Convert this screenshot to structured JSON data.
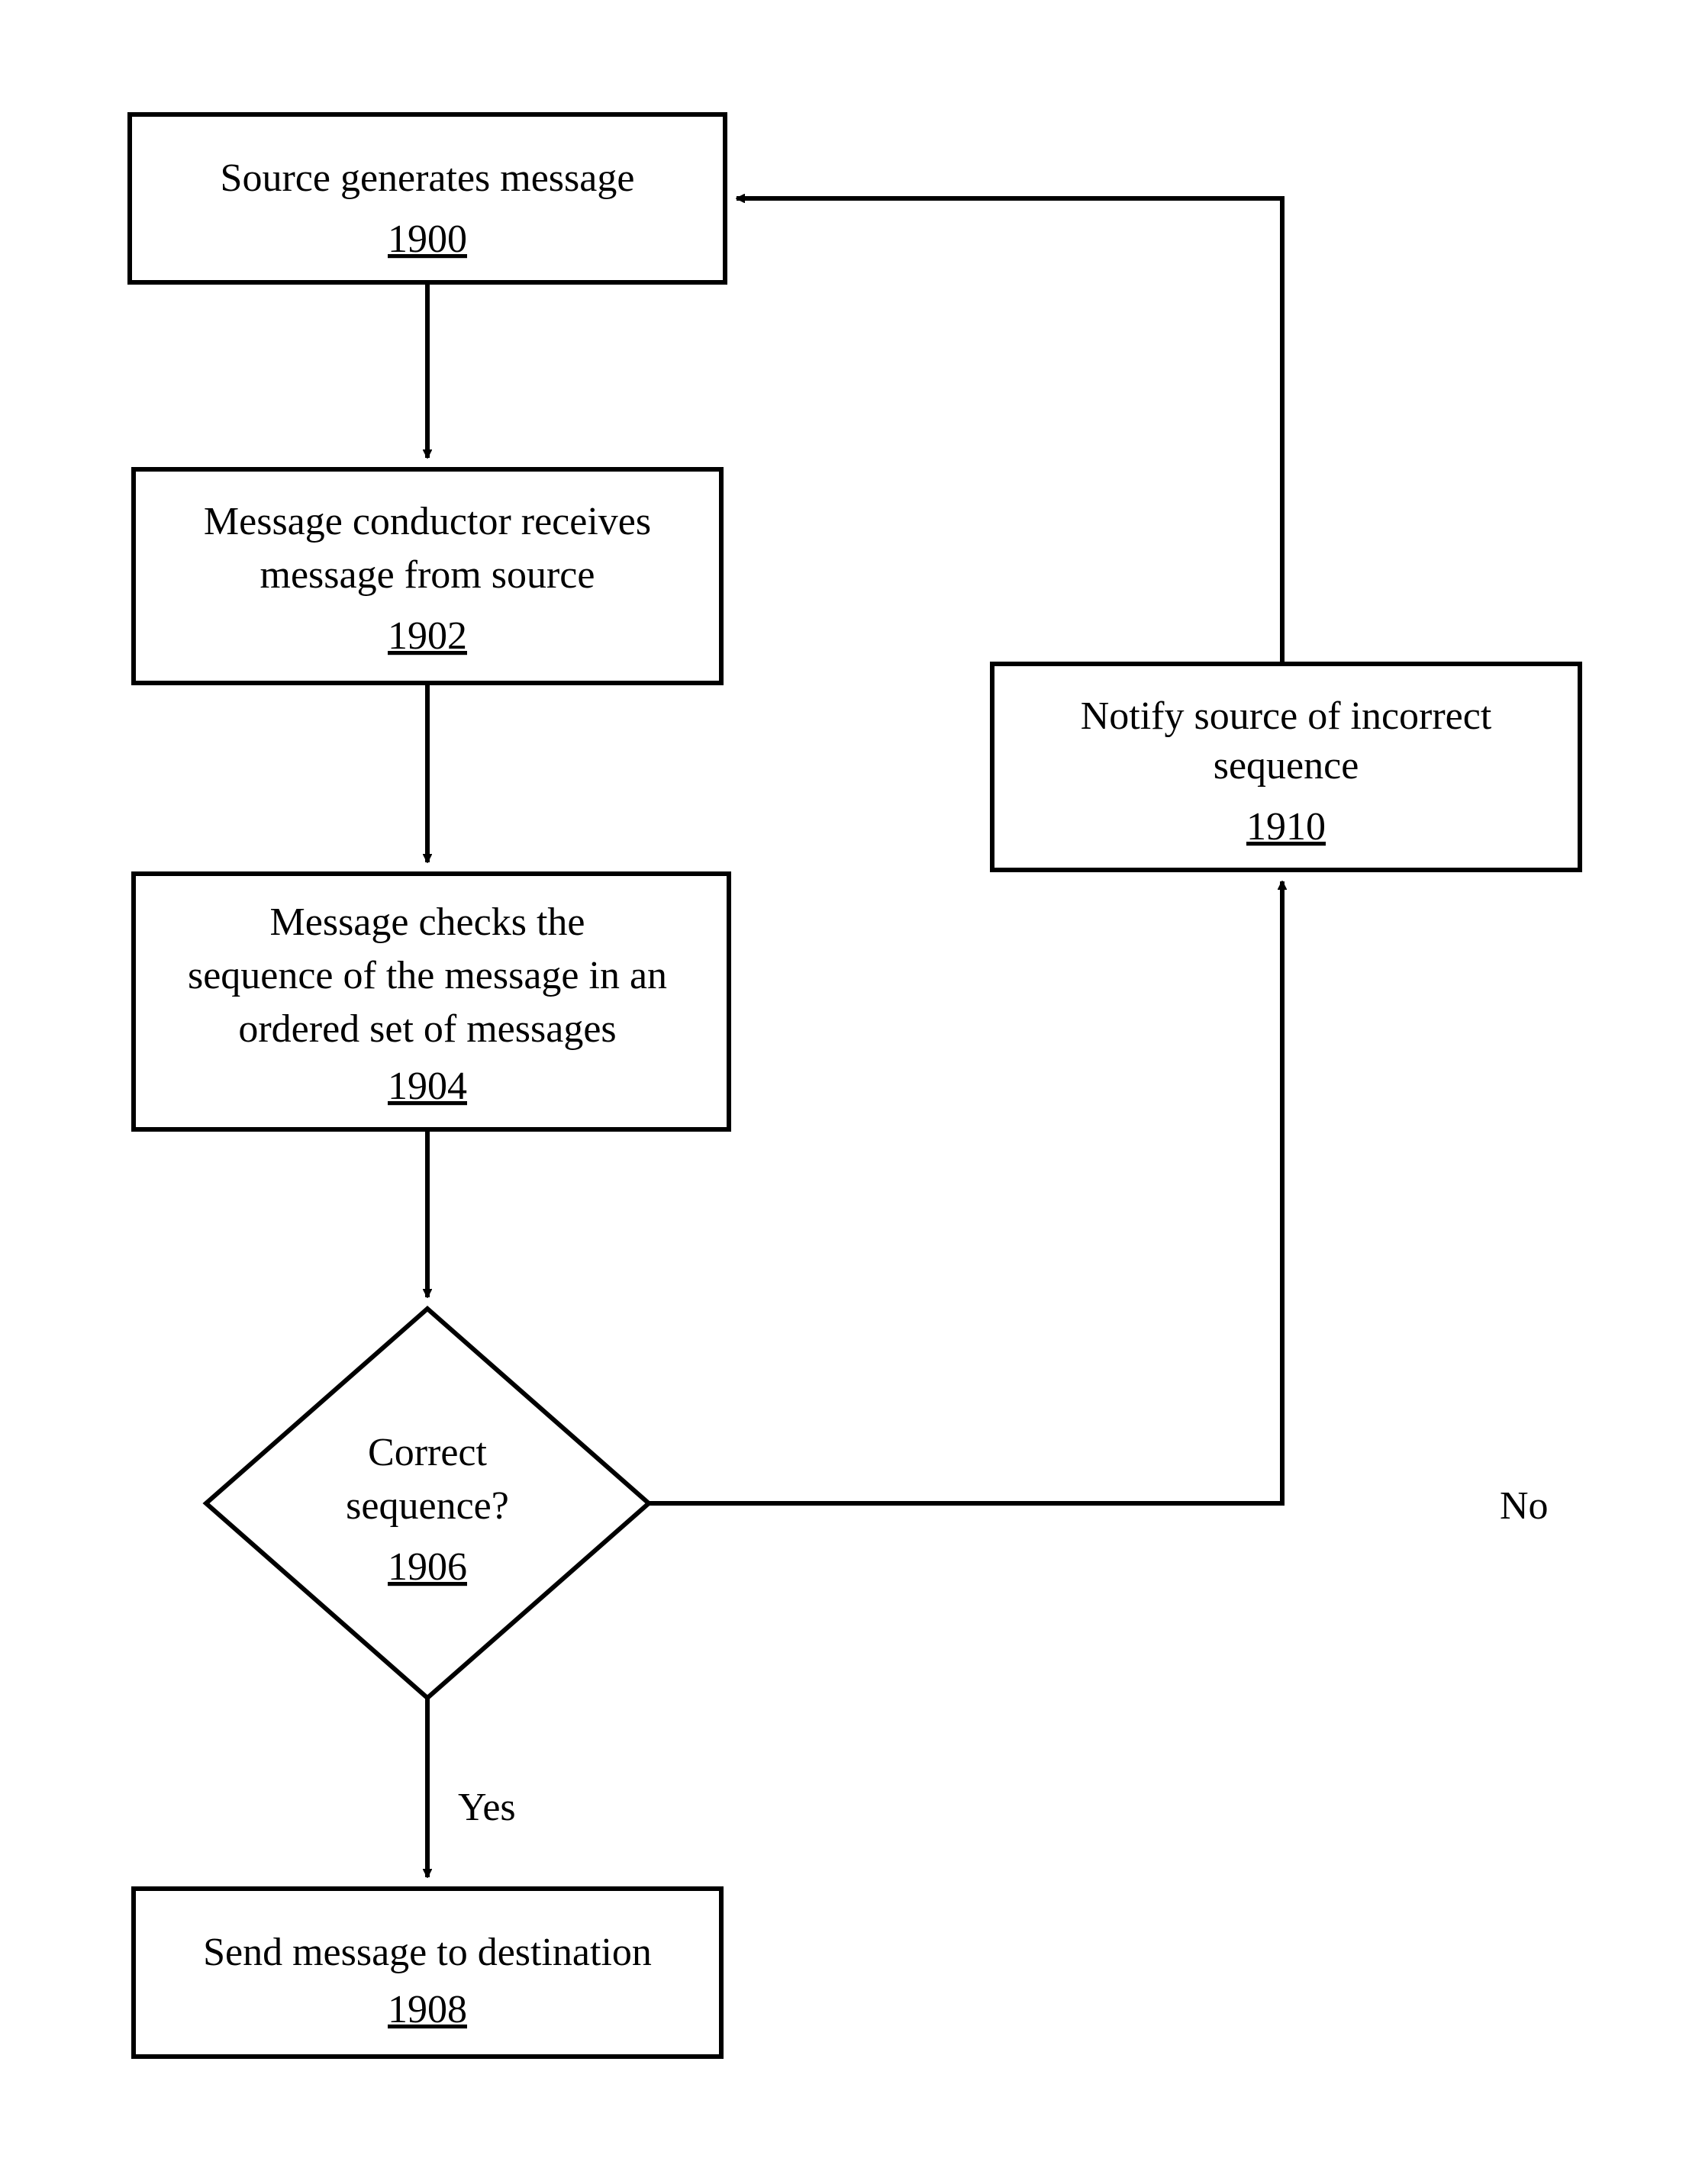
{
  "nodes": {
    "n1": {
      "text": "Source generates message",
      "num": "1900"
    },
    "n2": {
      "text1": "Message conductor receives",
      "text2": "message from source",
      "num": "1902"
    },
    "n3": {
      "text1": "Message checks the",
      "text2": "sequence of the message in an",
      "text3": "ordered set of messages",
      "num": "1904"
    },
    "dnode": {
      "text1": "Correct",
      "text2": "sequence?",
      "num": "1906"
    },
    "n5": {
      "text": "Send message to destination",
      "num": "1908"
    },
    "n6": {
      "text1": "Notify source of incorrect",
      "text2": "sequence",
      "num": "1910"
    }
  },
  "labels": {
    "yes": "Yes",
    "no": "No"
  }
}
